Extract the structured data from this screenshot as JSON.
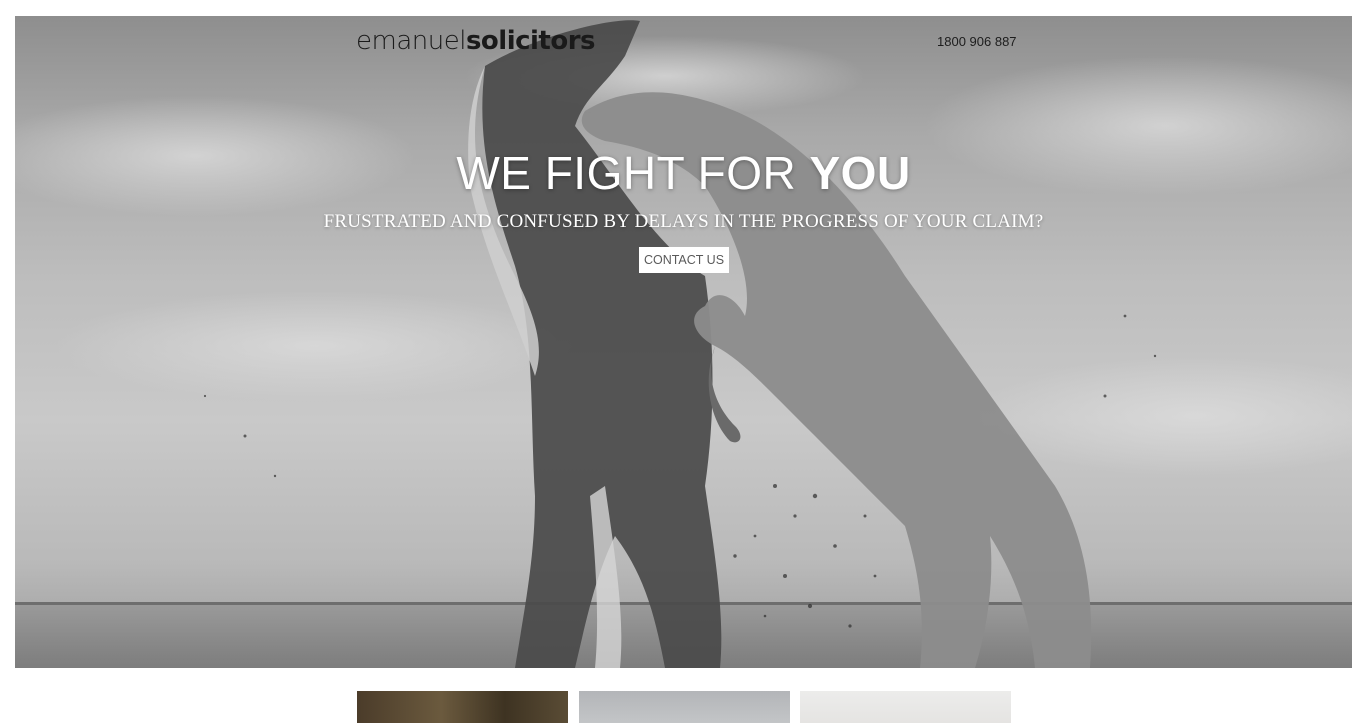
{
  "header": {
    "logo_light": "emanuel",
    "logo_bold": "solicitors",
    "phone": "1800 906 887"
  },
  "hero": {
    "headline_thin": "WE FIGHT FOR ",
    "headline_bold": "YOU",
    "subheadline": "FRUSTRATED AND CONFUSED BY DELAYS IN THE PROGRESS OF YOUR CLAIM?",
    "cta_label": "CONTACT US"
  }
}
